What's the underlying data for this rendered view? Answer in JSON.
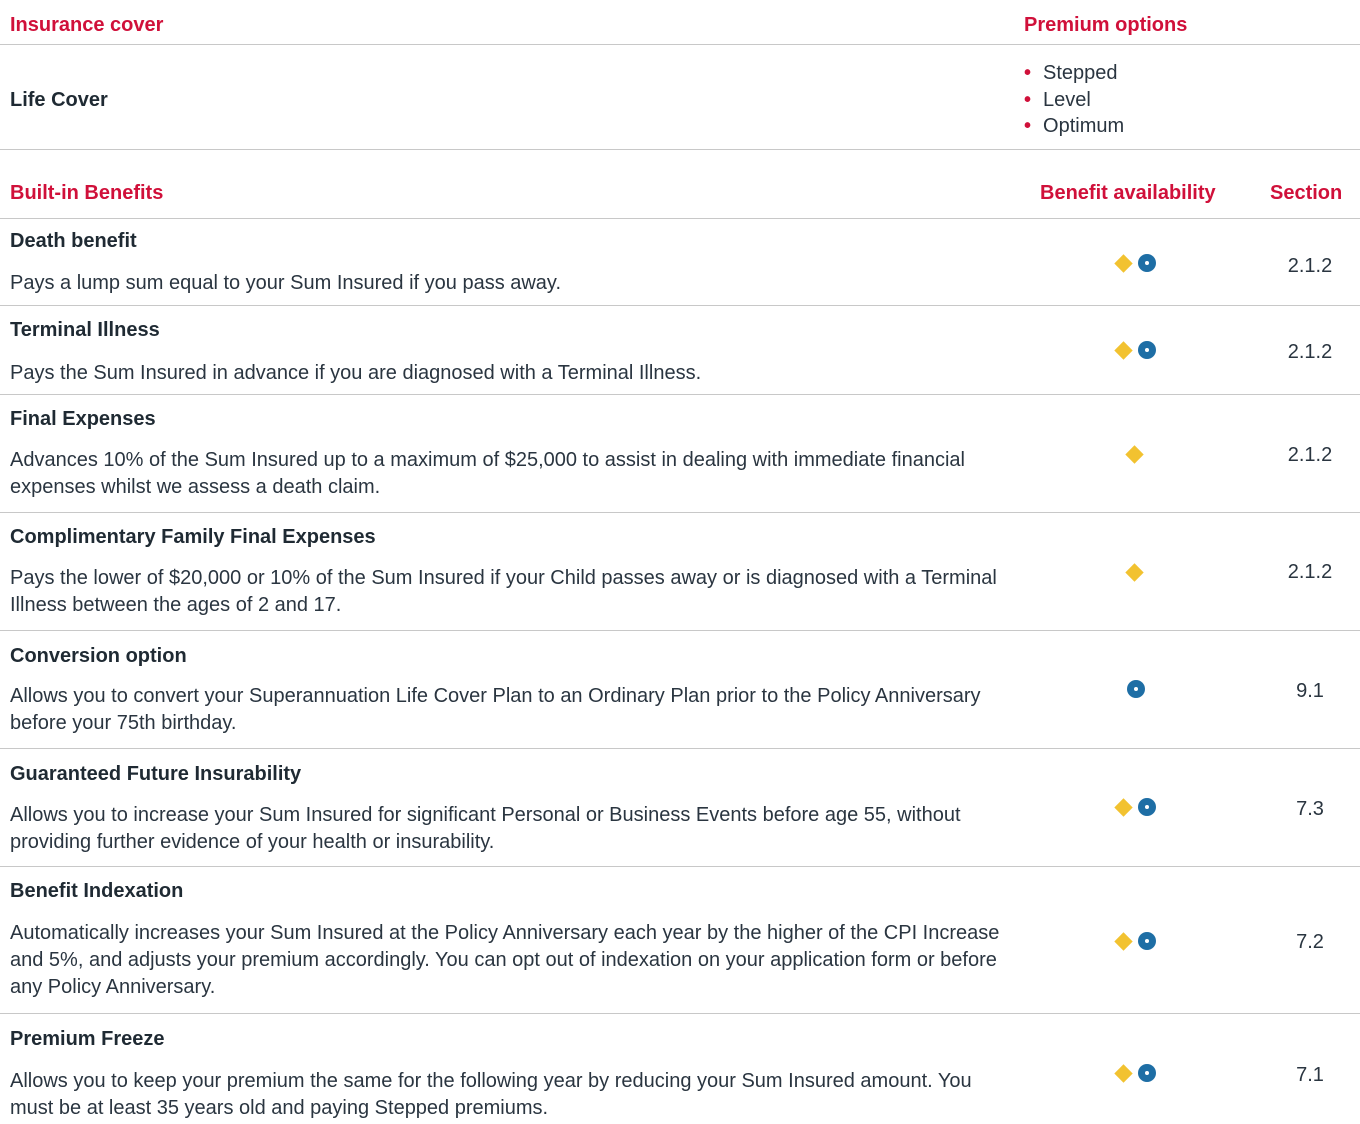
{
  "cover_table": {
    "header_insurance_cover": "Insurance cover",
    "header_premium_options": "Premium options",
    "cover_name": "Life Cover",
    "premium_options": [
      "Stepped",
      "Level",
      "Optimum"
    ]
  },
  "benefits_table": {
    "header_built_in": "Built-in Benefits",
    "header_availability": "Benefit availability",
    "header_section": "Section",
    "benefits": [
      {
        "title": "Death benefit",
        "description": "Pays a lump sum equal to your Sum Insured if you pass away.",
        "availability": [
          "diamond",
          "circle"
        ],
        "section": "2.1.2"
      },
      {
        "title": "Terminal Illness",
        "description": "Pays the Sum Insured in advance if you are diagnosed with a Terminal Illness.",
        "availability": [
          "diamond",
          "circle"
        ],
        "section": "2.1.2"
      },
      {
        "title": "Final Expenses",
        "description": "Advances 10% of the Sum Insured up to a maximum of $25,000 to assist in dealing with immediate financial expenses whilst we assess a death claim.",
        "availability": [
          "diamond"
        ],
        "section": "2.1.2"
      },
      {
        "title": "Complimentary Family Final Expenses",
        "description": "Pays the lower of $20,000 or 10% of the Sum Insured if your Child passes away or is diagnosed with a Terminal Illness between the ages of 2 and 17.",
        "availability": [
          "diamond"
        ],
        "section": "2.1.2"
      },
      {
        "title": "Conversion option",
        "description": "Allows you to convert your Superannuation Life Cover Plan to an Ordinary Plan prior to the Policy Anniversary before your 75th birthday.",
        "availability": [
          "circle"
        ],
        "section": "9.1"
      },
      {
        "title": "Guaranteed Future Insurability",
        "description": "Allows you to increase your Sum Insured for significant Personal or Business Events before age 55, without providing further evidence of your health or insurability.",
        "availability": [
          "diamond",
          "circle"
        ],
        "section": "7.3"
      },
      {
        "title": "Benefit Indexation",
        "description": "Automatically increases your Sum Insured at the Policy Anniversary each year by the higher of the CPI Increase and 5%, and adjusts your premium accordingly. You can opt out of indexation on your application form or before any Policy Anniversary.",
        "availability": [
          "diamond",
          "circle"
        ],
        "section": "7.2"
      },
      {
        "title": "Premium Freeze",
        "description": "Allows you to keep your premium the same for the following year by reducing your Sum Insured amount. You must be at least 35 years old and paying Stepped premiums.",
        "availability": [
          "diamond",
          "circle"
        ],
        "section": "7.1"
      }
    ]
  },
  "colors": {
    "header_red": "#d0103a",
    "diamond_yellow": "#f2c230",
    "circle_blue": "#1e6ea5",
    "rule_grey": "#c8c8c8"
  }
}
